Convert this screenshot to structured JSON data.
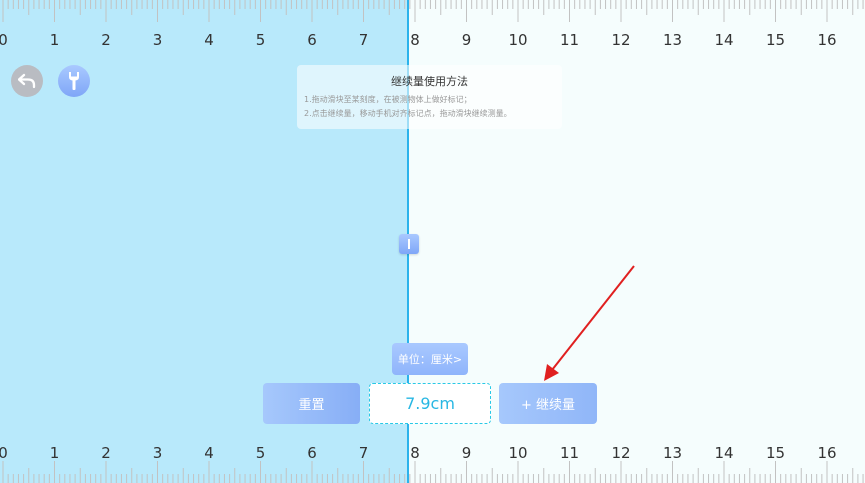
{
  "ruler": {
    "top_labels": [
      "0",
      "1",
      "2",
      "3",
      "4",
      "5",
      "6",
      "7",
      "8",
      "9",
      "10",
      "11",
      "12",
      "13",
      "14",
      "15",
      "16"
    ],
    "bottom_labels": [
      "0",
      "1",
      "2",
      "3",
      "4",
      "5",
      "6",
      "7",
      "8",
      "9",
      "10",
      "11",
      "12",
      "13",
      "14",
      "15",
      "16"
    ]
  },
  "measurement": {
    "value": "7.9cm"
  },
  "help": {
    "title": "继续量使用方法",
    "line1": "1.拖动滑块至某刻度，在被测物体上做好标记；",
    "line2": "2.点击继续量，移动手机对齐标记点，拖动滑块继续测量。"
  },
  "unit_button": {
    "label": "单位：厘米>"
  },
  "reset_button": {
    "label": "重置"
  },
  "continue_button": {
    "label": "+ 继续量"
  },
  "icons": {
    "back": "back-arrow-icon",
    "tool": "wrench-icon",
    "handle": "slider-handle-icon"
  },
  "colors": {
    "measured_fill": "#b8e9fb",
    "slider_line": "#2bb3ec",
    "button_gradient": "#8fb4fb",
    "value_text": "#28b7e3",
    "annotation_arrow": "#e02020"
  }
}
